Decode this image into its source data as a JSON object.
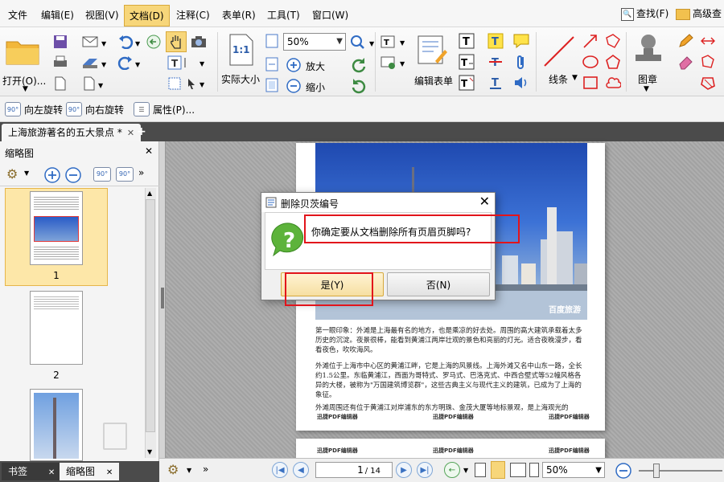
{
  "menu": {
    "items": [
      "文件",
      "编辑(E)",
      "视图(V)",
      "文档(D)",
      "注释(C)",
      "表单(R)",
      "工具(T)",
      "窗口(W)"
    ],
    "active": "文档(D)",
    "find_label": "查找(F)",
    "advanced_label": "高级查"
  },
  "ribbon": {
    "open_label": "打开(O)...",
    "zoom_value": "50%",
    "zoom_in_label": "放大",
    "zoom_out_label": "缩小",
    "actual_size_label": "实际大小",
    "actual_size_icon_text": "1:1",
    "edit_form_label": "编辑表单",
    "line_label": "线条",
    "stamp_label": "图章"
  },
  "subbar": {
    "rotate_left_label": "向左旋转",
    "rotate_right_label": "向右旋转",
    "properties_label": "属性(P)...",
    "rotate_icon_text": "90°"
  },
  "document": {
    "tab_title": "上海旅游著名的五大景点 *",
    "photo_watermark": "百度旅游",
    "paragraphs": [
      "第一眼印象：外滩是上海最有名的地方，也是乘凉的好去处。周围的高大建筑承载着太多历史的沉淀。夜景很棒，能看到黄浦江两岸壮观的景色和亮丽的灯光。适合夜晚漫步，看看夜色，吹吹海风。",
      "外滩位于上海市中心区的黄浦江畔，它是上海的风景线。上海外滩又名中山东一路，全长约1.5公里。东临黄浦江，西面为哥特式、罗马式、巴洛克式、中西合壁式等52幢风格各异的大楼，被称为\"万国建筑博览群\"，这些古典主义与现代主义的建筑，已成为了上海的象征。",
      "外滩周围还有位于黄浦江对岸浦东的东方明珠、金茂大厦等地标景观，是上海观光的"
    ],
    "footer_watermark": "迅捷PDF编辑器"
  },
  "thumbnails": {
    "panel_title": "缩略图",
    "pages": [
      "1",
      "2"
    ],
    "tab_bookmarks": "书签",
    "tab_thumbnails": "缩略图"
  },
  "dialog": {
    "title": "删除贝茨编号",
    "message": "你确定要从文档删除所有页眉页脚吗?",
    "yes_label": "是(Y)",
    "no_label": "否(N)"
  },
  "status": {
    "page_value": "1",
    "page_total": "/ 14",
    "zoom_value": "50%"
  },
  "colors": {
    "highlight": "#e2141b",
    "active_menu": "#f7d67a",
    "accent_blue": "#3b72c2"
  }
}
